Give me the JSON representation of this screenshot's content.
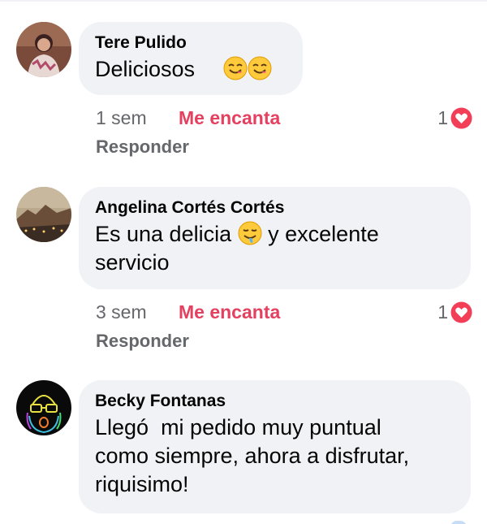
{
  "comments": [
    {
      "author": "Tere Pulido",
      "text": "Deliciosos",
      "emojis": [
        "smiling-face-savoring-food-icon",
        "smiling-face-savoring-food-icon"
      ],
      "time": "1 sem",
      "reaction_label": "Me encanta",
      "reaction_count": "1",
      "reply_label": "Responder"
    },
    {
      "author": "Angelina Cortés Cortés",
      "text_before": "Es una delicia",
      "emoji": "drooling-face-icon",
      "text_after": "y excelente",
      "text_line2": "servicio",
      "time": "3 sem",
      "reaction_label": "Me encanta",
      "reaction_count": "1",
      "reply_label": "Responder"
    },
    {
      "author": "Becky Fontanas",
      "text_lines": [
        "Llegó  mi pedido muy puntual",
        "como siempre, ahora a disfrutar,",
        "riquisimo!"
      ]
    }
  ],
  "colors": {
    "bubble": "#f0f2f5",
    "love_accent": "#e4405f",
    "secondary_text": "#65676b"
  }
}
